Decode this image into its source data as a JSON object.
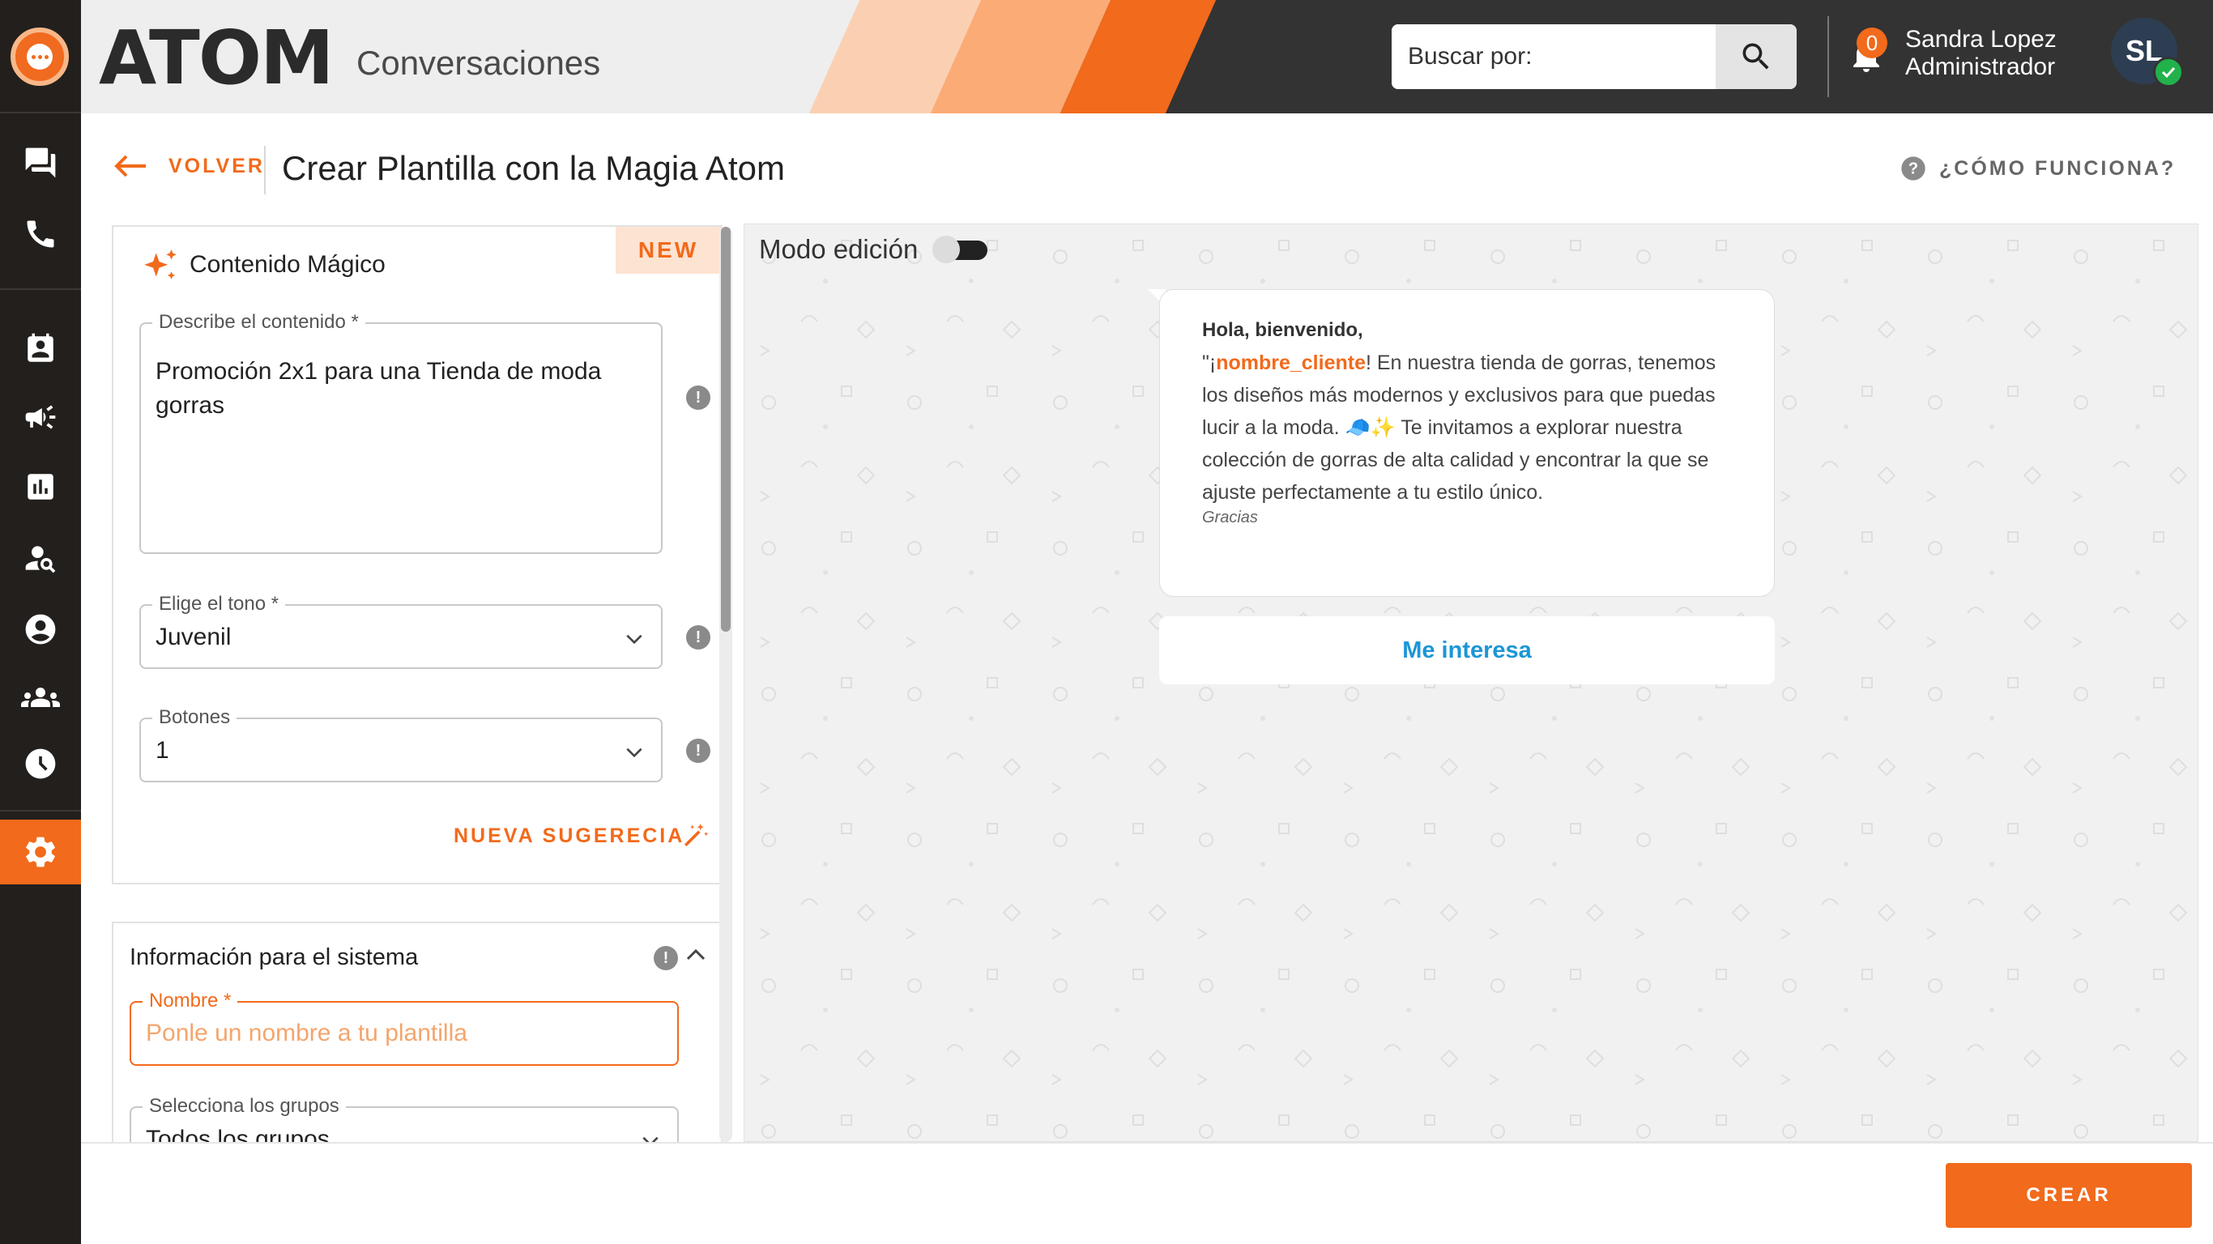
{
  "app": {
    "brand": "ATOM",
    "section": "Conversaciones"
  },
  "search": {
    "placeholder": "Buscar por:"
  },
  "notifications": {
    "count": "0"
  },
  "user": {
    "name": "Sandra Lopez",
    "role": "Administrador",
    "initials": "SL",
    "status": "online"
  },
  "sidebar": {
    "icons": [
      "chat-icon",
      "phone-icon",
      "contacts-icon",
      "campaigns-icon",
      "reports-icon",
      "user-search-icon",
      "profile-icon",
      "groups-icon",
      "history-icon",
      "settings-icon"
    ],
    "active": "settings-icon"
  },
  "page": {
    "back_label": "VOLVER",
    "title": "Crear Plantilla con la Magia Atom",
    "help_label": "¿CÓMO FUNCIONA?"
  },
  "magic": {
    "title": "Contenido Mágico",
    "badge": "NEW",
    "description_label": "Describe el contenido *",
    "description_value": "Promoción 2x1 para una Tienda de moda gorras",
    "tone_label": "Elige el tono *",
    "tone_value": "Juvenil",
    "buttons_label": "Botones",
    "buttons_value": "1",
    "suggest_label": "NUEVA SUGERECIA"
  },
  "system": {
    "title": "Información para el sistema",
    "name_label": "Nombre *",
    "name_placeholder": "Ponle un nombre a tu plantilla",
    "groups_label": "Selecciona los grupos",
    "groups_value": "Todos los grupos"
  },
  "preview": {
    "mode_label": "Modo edición",
    "mode_on": false,
    "header": "Hola, bienvenido,",
    "body_prefix": "\"¡",
    "variable": "nombre_cliente",
    "body_text": "! En nuestra tienda de gorras, tenemos los diseños más modernos y exclusivos para que puedas lucir a la moda. 🧢✨ Te invitamos a explorar nuestra colección de gorras de alta calidad y encontrar la que se ajuste perfectamente a tu estilo único.",
    "footer": "Gracias",
    "button": "Me interesa"
  },
  "actions": {
    "create_label": "CREAR"
  },
  "colors": {
    "accent": "#f26a1b",
    "sidebar": "#221f1d",
    "header_dark": "#333333",
    "link": "#1c96d6"
  }
}
